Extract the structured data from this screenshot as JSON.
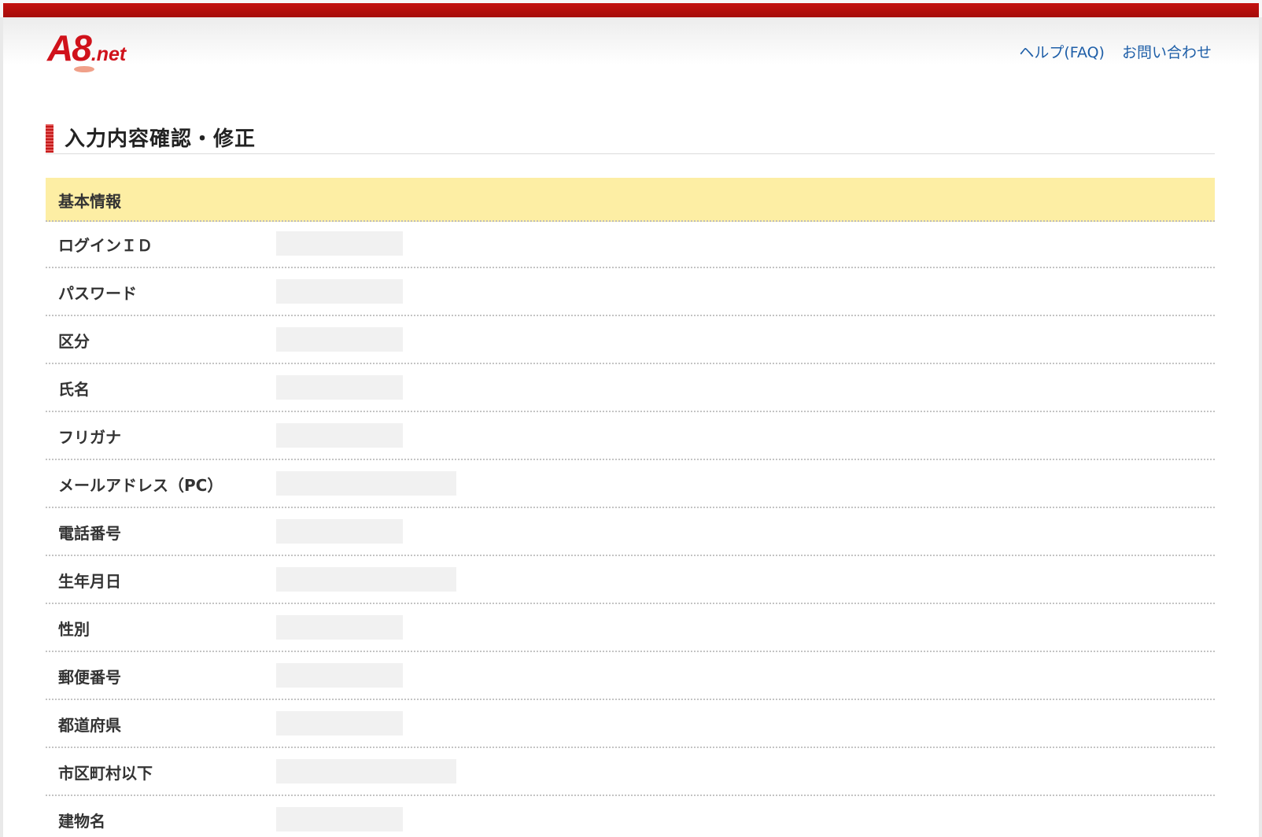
{
  "header": {
    "logo": "A8.net",
    "links": [
      {
        "label": "ヘルプ(FAQ)"
      },
      {
        "label": "お問い合わせ"
      }
    ]
  },
  "page": {
    "title": "入力内容確認・修正"
  },
  "section": {
    "title": "基本情報",
    "rows": [
      {
        "label": "ログインＩＤ",
        "value": ""
      },
      {
        "label": "パスワード",
        "value": ""
      },
      {
        "label": "区分",
        "value": ""
      },
      {
        "label": "氏名",
        "value": ""
      },
      {
        "label": "フリガナ",
        "value": ""
      },
      {
        "label": "メールアドレス（PC）",
        "value": ""
      },
      {
        "label": "電話番号",
        "value": ""
      },
      {
        "label": "生年月日",
        "value": ""
      },
      {
        "label": "性別",
        "value": ""
      },
      {
        "label": "郵便番号",
        "value": ""
      },
      {
        "label": "都道府県",
        "value": ""
      },
      {
        "label": "市区町村以下",
        "value": ""
      },
      {
        "label": "建物名",
        "value": ""
      }
    ]
  },
  "colors": {
    "brand_red": "#c4120f",
    "link_blue": "#1f5fa8",
    "section_yellow": "#fdeea4"
  }
}
